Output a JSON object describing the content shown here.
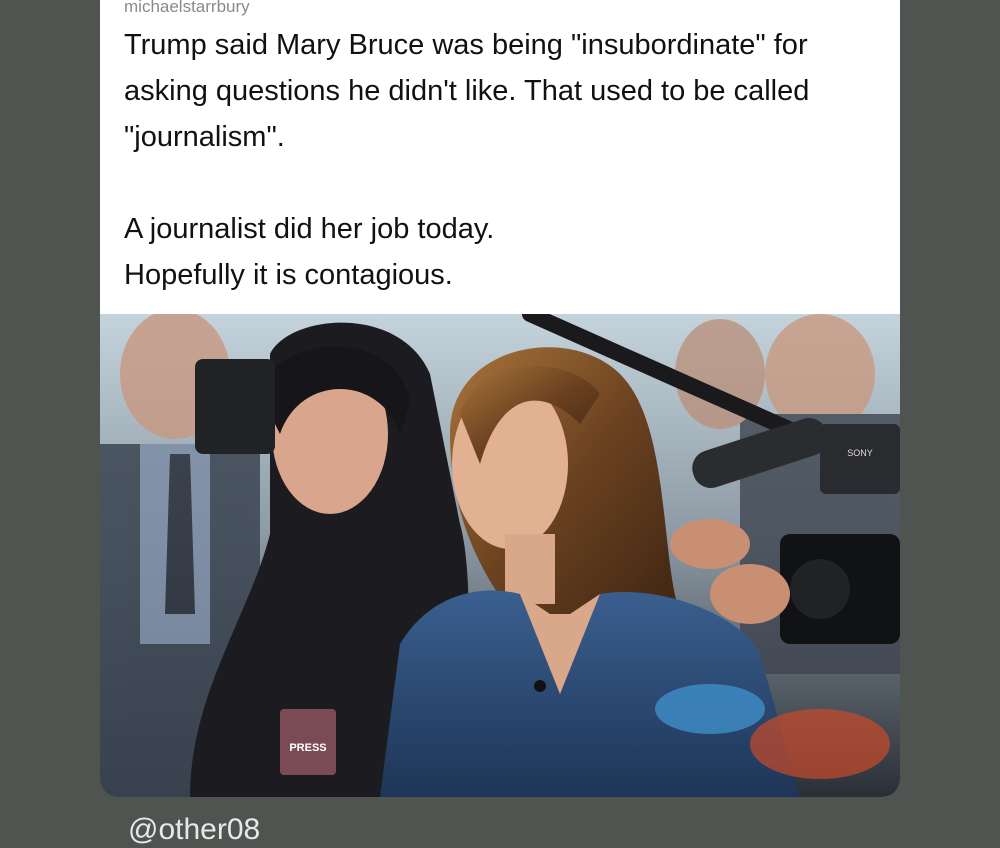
{
  "post": {
    "username": "michaelstarrbury",
    "paragraph1": "Trump said Mary Bruce was being \"insubordinate\" for asking questions he didn't like. That used to be called \"journalism\".",
    "line2": "A journalist did her job today.",
    "line3": "Hopefully it is contagious.",
    "press_badge": "PRESS",
    "camera_brand": "SONY"
  },
  "footer": {
    "handle": "@other08"
  },
  "colors": {
    "background": "#4f5450",
    "card": "#ffffff",
    "jacket": "#2c4a72"
  }
}
